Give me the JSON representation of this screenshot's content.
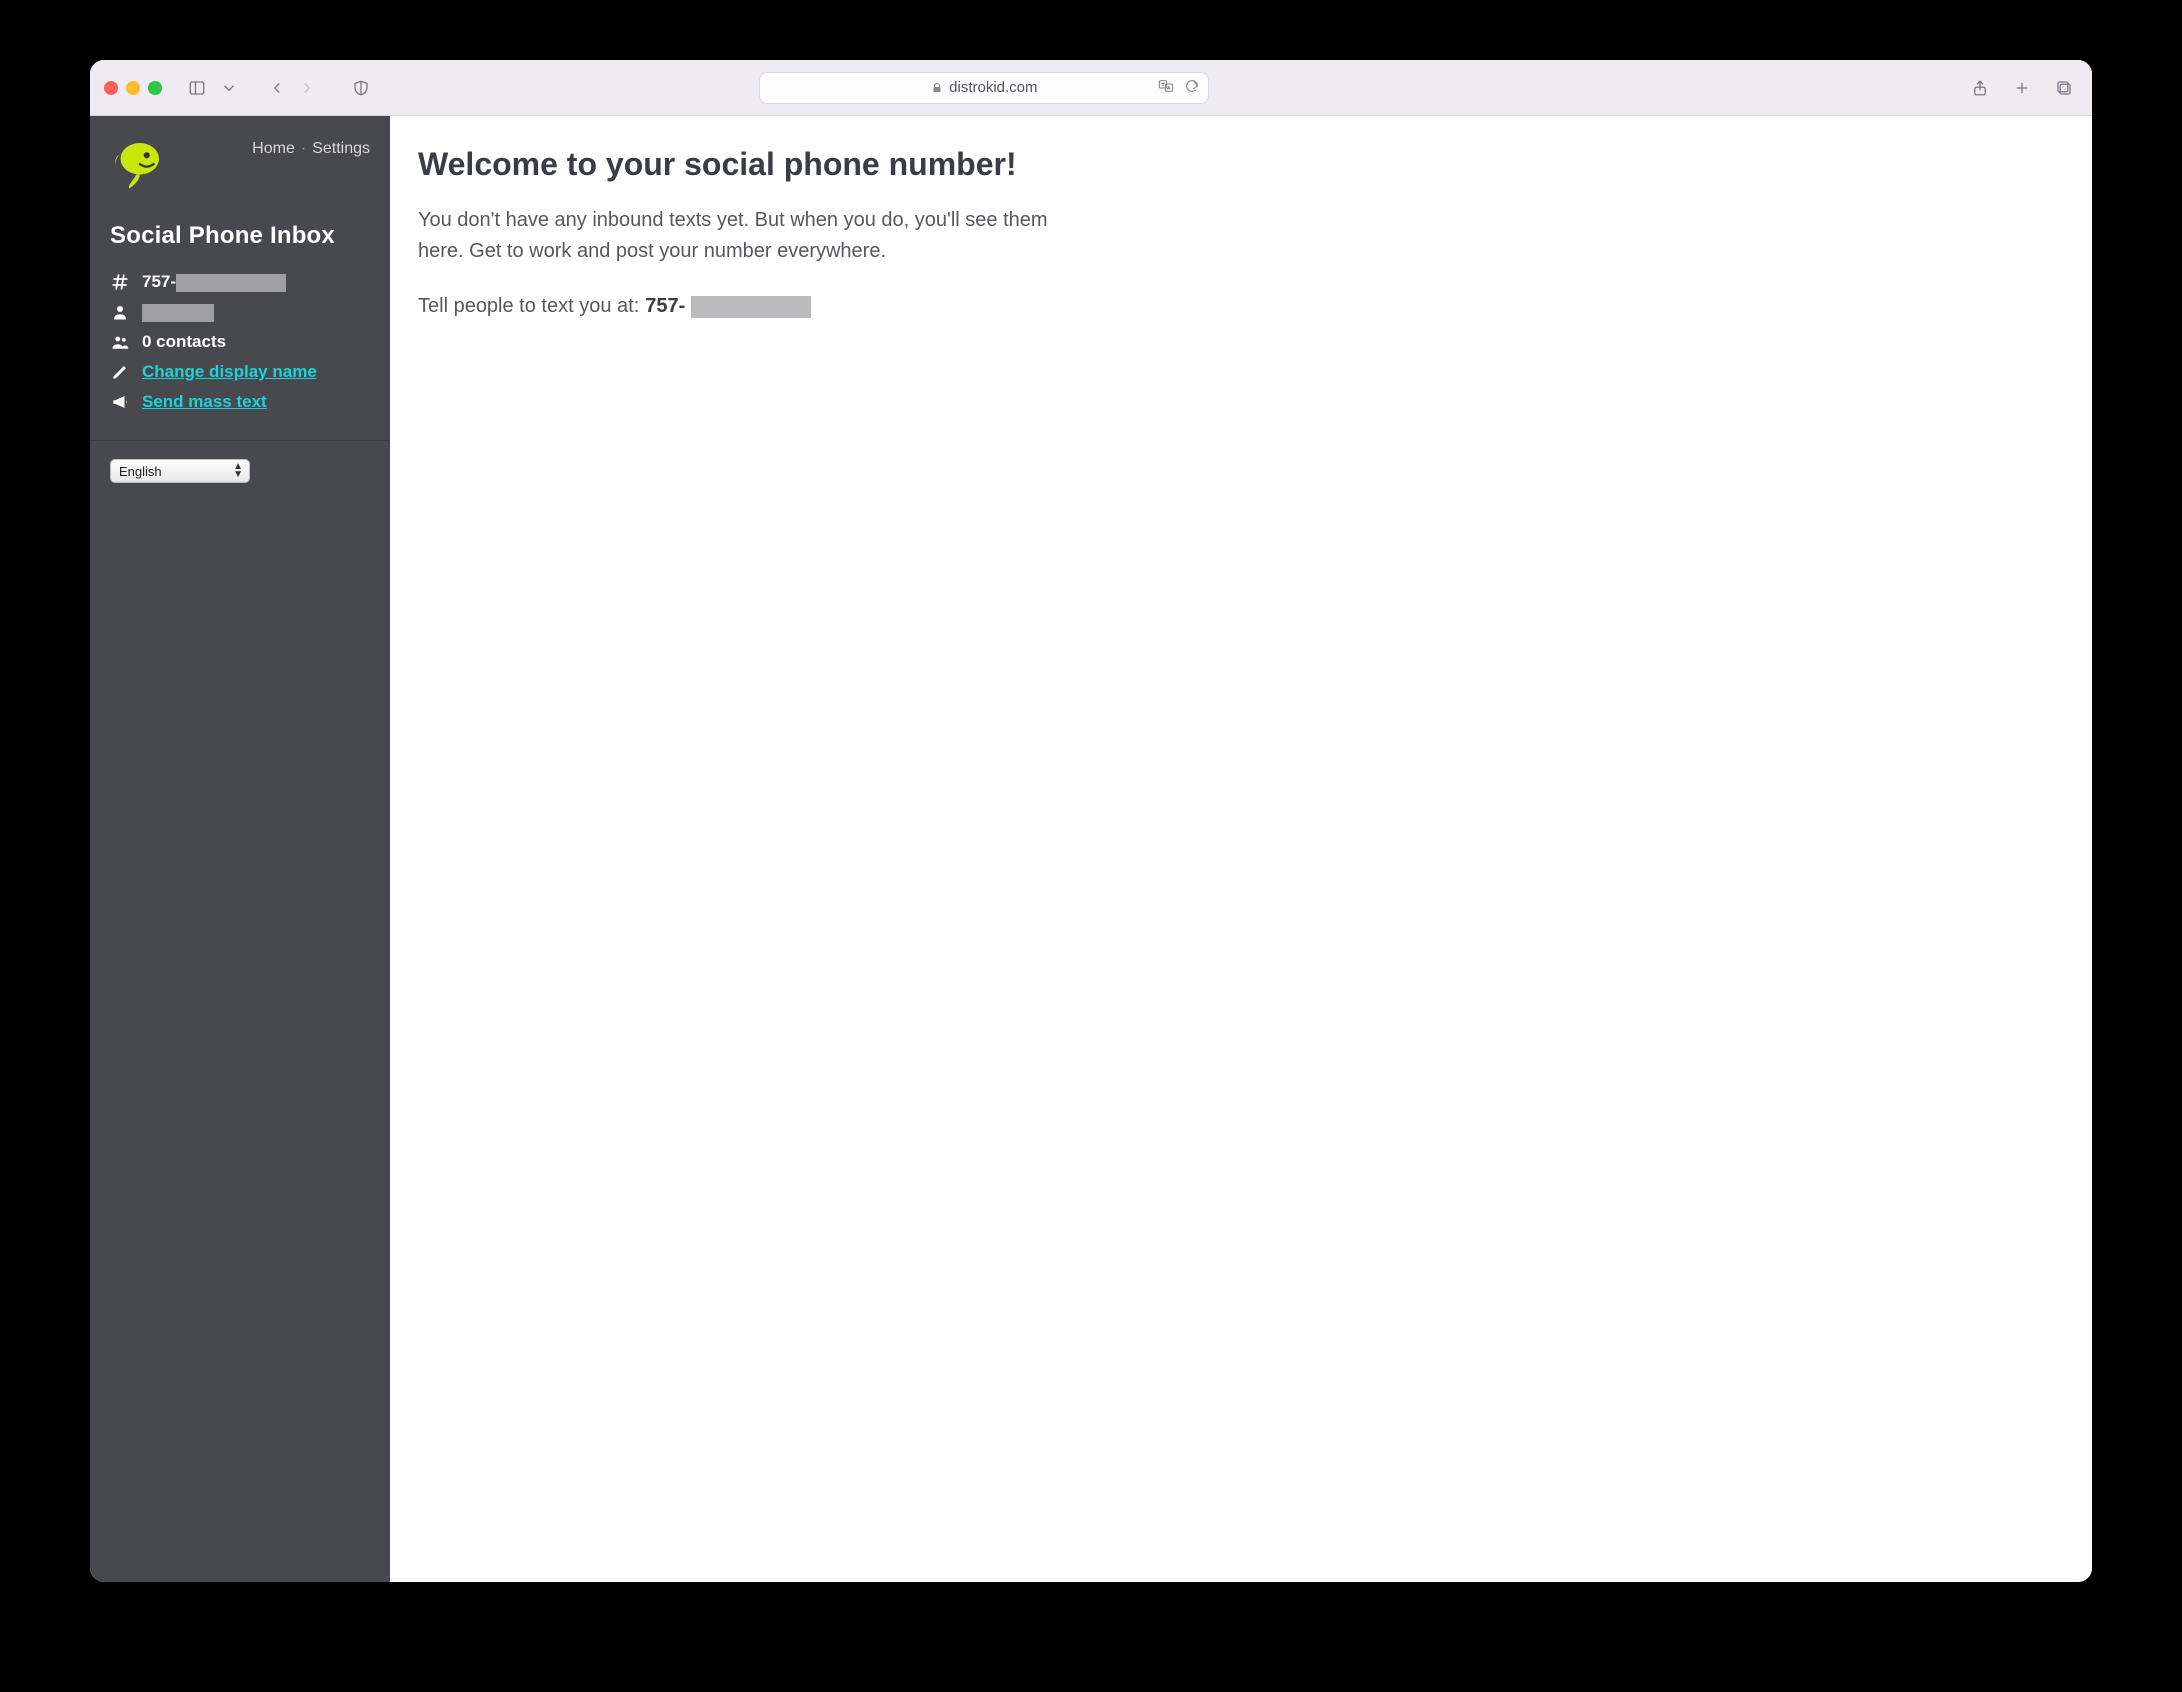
{
  "browser": {
    "domain": "distrokid.com"
  },
  "sidebar": {
    "nav": {
      "home": "Home",
      "settings": "Settings"
    },
    "title": "Social Phone Inbox",
    "phone_prefix": "757-",
    "contacts_label": "0 contacts",
    "change_name_label": "Change display name",
    "mass_text_label": "Send mass text",
    "language": "English"
  },
  "main": {
    "heading": "Welcome to your social phone number!",
    "body": "You don't have any inbound texts yet. But when you do, you'll see them here. Get to work and post your number everywhere.",
    "tell_prefix": "Tell people to text you at:",
    "tell_number_prefix": "757-"
  }
}
